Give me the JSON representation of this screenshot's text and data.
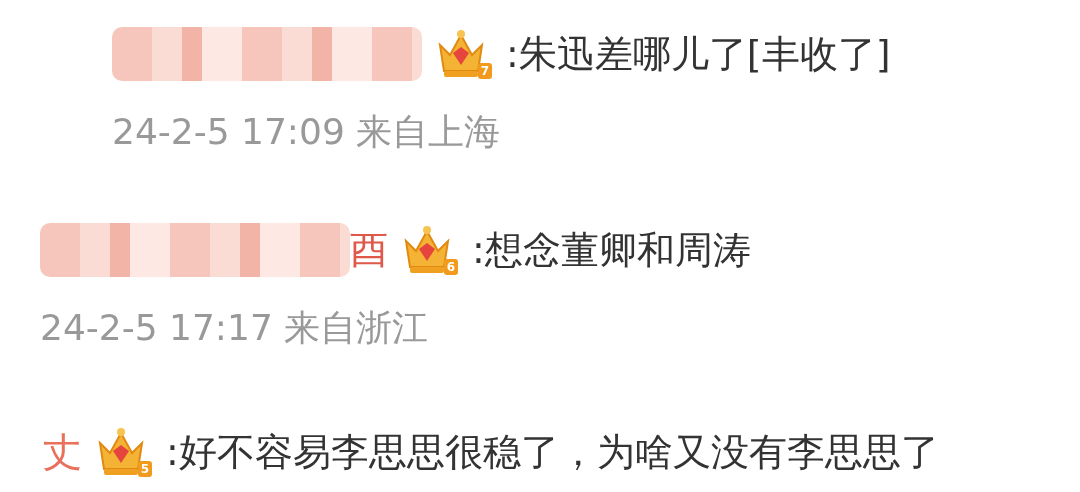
{
  "comments": [
    {
      "name_blurred": true,
      "badge": "7",
      "text": ":朱迅差哪儿了[丰收了]",
      "meta": "24-2-5 17:09 来自上海"
    },
    {
      "name_blurred": true,
      "name_tail": "酉",
      "badge": "6",
      "text": ":想念董卿和周涛",
      "meta": "24-2-5 17:17 来自浙江"
    },
    {
      "name": "丈",
      "badge": "5",
      "text": ":好不容易李思思很稳了，为啥又没有李思思了"
    }
  ]
}
